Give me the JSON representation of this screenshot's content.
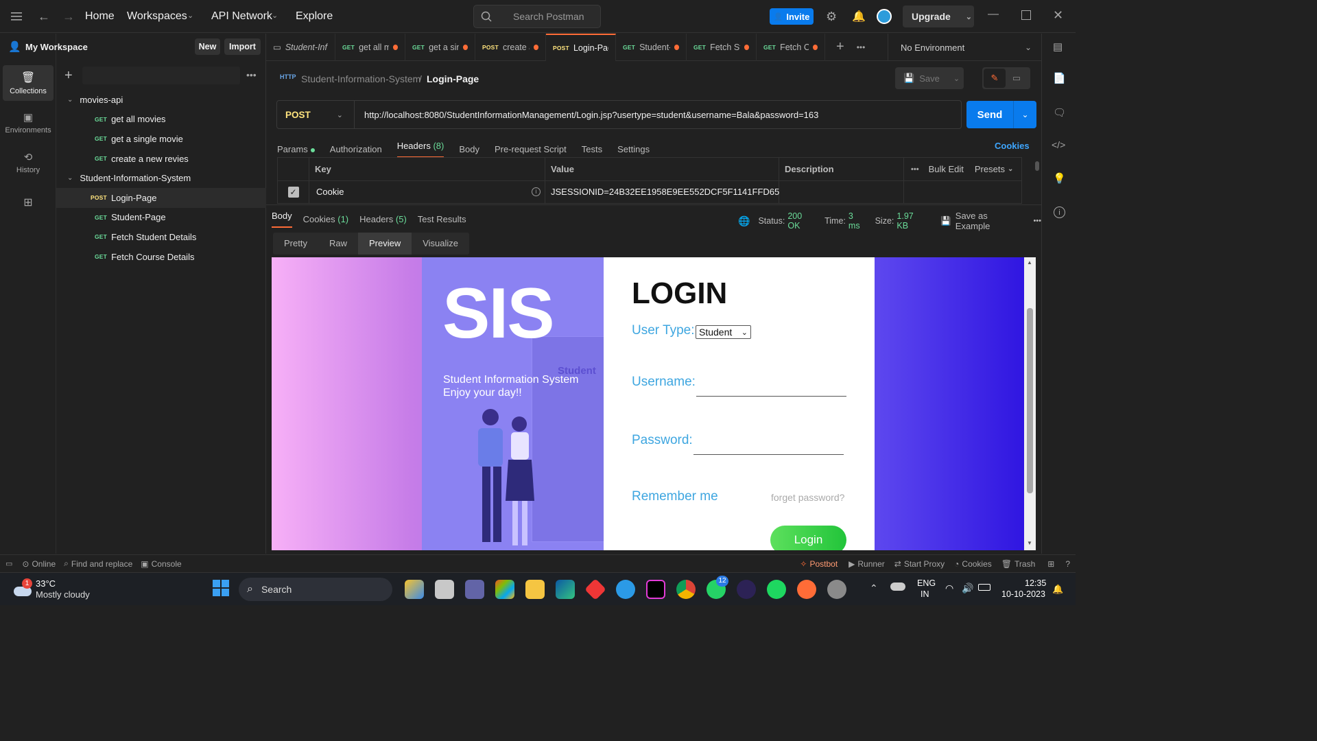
{
  "topbar": {
    "nav": [
      "Home",
      "Workspaces",
      "API Network",
      "Explore"
    ],
    "search_placeholder": "Search Postman",
    "invite_label": "Invite",
    "upgrade_label": "Upgrade"
  },
  "rail": {
    "items": [
      {
        "label": "Collections",
        "icon": "collections-icon"
      },
      {
        "label": "Environments",
        "icon": "environments-icon"
      },
      {
        "label": "History",
        "icon": "history-icon"
      }
    ]
  },
  "sidebar": {
    "workspace_title": "My Workspace",
    "new_label": "New",
    "import_label": "Import",
    "collections": [
      {
        "name": "movies-api",
        "requests": [
          {
            "method": "GET",
            "name": "get all movies"
          },
          {
            "method": "GET",
            "name": "get a single movie"
          },
          {
            "method": "GET",
            "name": "create a new revies"
          }
        ]
      },
      {
        "name": "Student-Information-System",
        "requests": [
          {
            "method": "POST",
            "name": "Login-Page"
          },
          {
            "method": "GET",
            "name": "Student-Page"
          },
          {
            "method": "GET",
            "name": "Fetch Student Details"
          },
          {
            "method": "GET",
            "name": "Fetch Course Details"
          }
        ]
      }
    ]
  },
  "tabs": [
    {
      "method": "",
      "name": "Student-Inf"
    },
    {
      "method": "GET",
      "name": "get all m"
    },
    {
      "method": "GET",
      "name": "get a sin"
    },
    {
      "method": "POST",
      "name": "create a"
    },
    {
      "method": "POST",
      "name": "Login-Pag"
    },
    {
      "method": "GET",
      "name": "Student-"
    },
    {
      "method": "GET",
      "name": "Fetch Stu"
    },
    {
      "method": "GET",
      "name": "Fetch Co"
    }
  ],
  "environment": "No Environment",
  "request": {
    "breadcrumb_collection": "Student-Information-System",
    "breadcrumb_sep": "/",
    "breadcrumb_request": "Login-Page",
    "save_label": "Save",
    "method": "POST",
    "url": "http://localhost:8080/StudentInformationManagement/Login.jsp?usertype=student&username=Bala&password=163",
    "send_label": "Send",
    "subtabs": [
      "Params",
      "Authorization",
      "Headers",
      "Body",
      "Pre-request Script",
      "Tests",
      "Settings"
    ],
    "headers_count": "(8)",
    "cookies_link": "Cookies",
    "table": {
      "columns": [
        "Key",
        "Value",
        "Description"
      ],
      "bulk_edit": "Bulk Edit",
      "presets": "Presets",
      "row": {
        "key": "Cookie",
        "value": "JSESSIONID=24B32EE1958E9EE552DCF5F1141FFD65"
      }
    }
  },
  "response": {
    "tabs": [
      "Body",
      "Cookies",
      "Headers",
      "Test Results"
    ],
    "cookies_count": "(1)",
    "headers_count": "(5)",
    "status_label": "Status:",
    "status_value": "200 OK",
    "time_label": "Time:",
    "time_value": "3 ms",
    "size_label": "Size:",
    "size_value": "1.97 KB",
    "save_example": "Save as Example",
    "view_modes": [
      "Pretty",
      "Raw",
      "Preview",
      "Visualize"
    ]
  },
  "preview": {
    "brand": "SIS",
    "tagline1": "Student Information System",
    "tagline2": "Enjoy your day!!",
    "card_label": "Student",
    "login_title": "LOGIN",
    "user_type_label": "User Type:",
    "user_type_value": "Student",
    "username_label": "Username:",
    "password_label": "Password:",
    "remember": "Remember me",
    "forget": "forget password?",
    "login_button": "Login"
  },
  "statusbar": {
    "online": "Online",
    "find_replace": "Find and replace",
    "console": "Console",
    "postbot": "Postbot",
    "runner": "Runner",
    "start_proxy": "Start Proxy",
    "cookies": "Cookies",
    "trash": "Trash"
  },
  "taskbar": {
    "weather_badge": "1",
    "temperature": "33°C",
    "weather": "Mostly cloudy",
    "search_label": "Search",
    "whatsapp_badge": "12",
    "lang1": "ENG",
    "lang2": "IN",
    "time": "12:35",
    "date": "10-10-2023"
  },
  "colors": {
    "accent_orange": "#ff6c37",
    "send_blue": "#097bed",
    "status_green": "#6bdd9a"
  }
}
